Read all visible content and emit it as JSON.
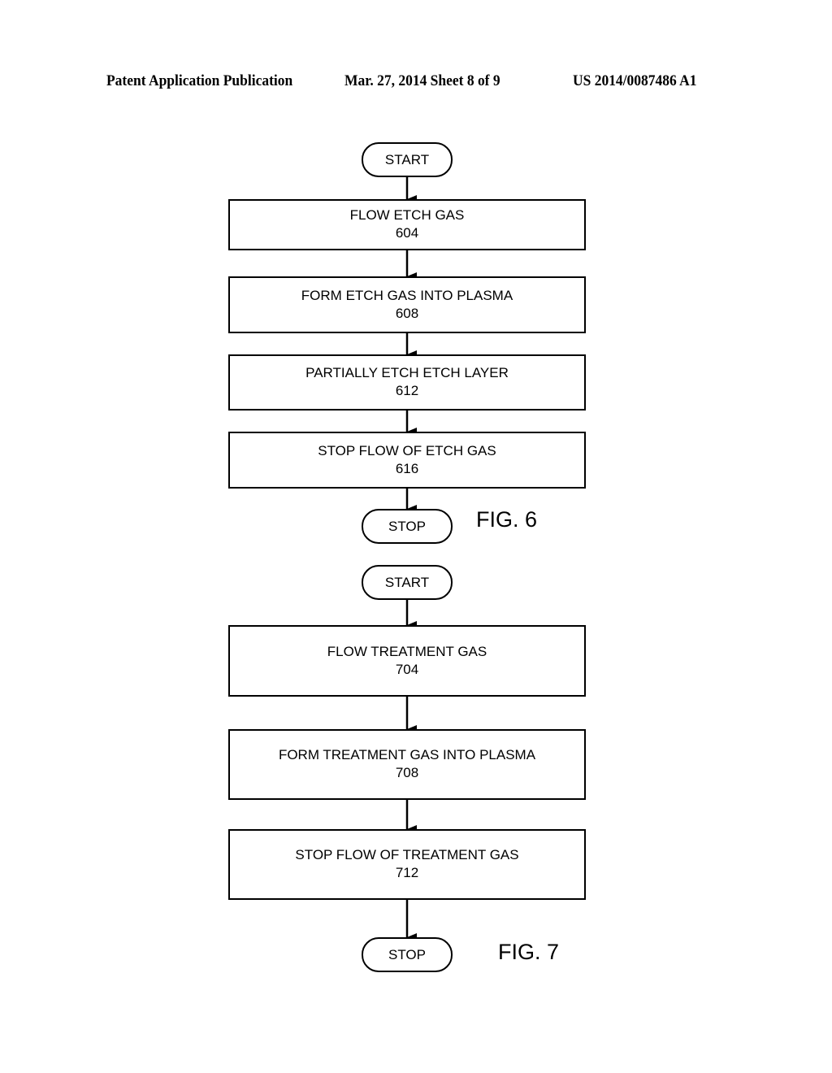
{
  "header": {
    "publication": "Patent Application Publication",
    "date_sheet": "Mar. 27, 2014  Sheet 8 of 9",
    "number": "US 2014/0087486 A1"
  },
  "fig6": {
    "label": "FIG. 6",
    "start": "START",
    "stop": "STOP",
    "steps": [
      {
        "text": "FLOW ETCH GAS",
        "ref": "604"
      },
      {
        "text": "FORM ETCH GAS INTO PLASMA",
        "ref": "608"
      },
      {
        "text": "PARTIALLY ETCH ETCH LAYER",
        "ref": "612"
      },
      {
        "text": "STOP FLOW OF ETCH GAS",
        "ref": "616"
      }
    ]
  },
  "fig7": {
    "label": "FIG. 7",
    "start": "START",
    "stop": "STOP",
    "steps": [
      {
        "text": "FLOW TREATMENT GAS",
        "ref": "704"
      },
      {
        "text": "FORM TREATMENT GAS INTO PLASMA",
        "ref": "708"
      },
      {
        "text": "STOP FLOW OF TREATMENT GAS",
        "ref": "712"
      }
    ]
  }
}
